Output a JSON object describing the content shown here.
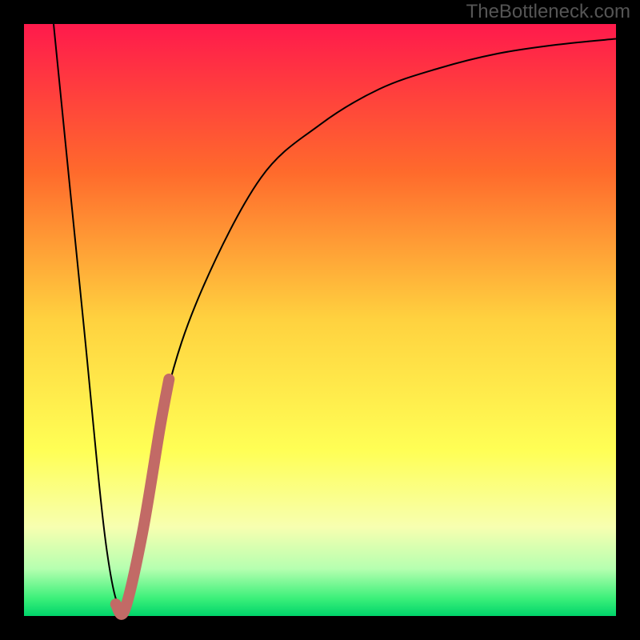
{
  "watermark": "TheBottleneck.com",
  "chart_data": {
    "type": "line",
    "title": "",
    "xlabel": "",
    "ylabel": "",
    "xlim": [
      0,
      100
    ],
    "ylim": [
      0,
      100
    ],
    "series": [
      {
        "name": "black-curve",
        "x": [
          5,
          10,
          14,
          17,
          20,
          24,
          30,
          40,
          50,
          60,
          70,
          80,
          90,
          100
        ],
        "values": [
          100,
          50,
          11,
          1,
          14,
          37,
          55,
          74,
          83,
          89,
          92.5,
          95,
          96.5,
          97.5
        ]
      },
      {
        "name": "highlight-segment",
        "x": [
          15.5,
          17,
          20,
          23,
          24.5
        ],
        "values": [
          2,
          1,
          14,
          32,
          40
        ]
      }
    ],
    "plot_background": {
      "stops": [
        {
          "pos": 0.0,
          "color": "#ff1a4c"
        },
        {
          "pos": 0.25,
          "color": "#ff6a2c"
        },
        {
          "pos": 0.5,
          "color": "#ffd23f"
        },
        {
          "pos": 0.72,
          "color": "#ffff55"
        },
        {
          "pos": 0.85,
          "color": "#f7ffb0"
        },
        {
          "pos": 0.92,
          "color": "#b6ffb0"
        },
        {
          "pos": 0.97,
          "color": "#3cf07a"
        },
        {
          "pos": 1.0,
          "color": "#00d46a"
        }
      ]
    },
    "frame_color": "#000000",
    "frame_thickness": 30,
    "highlight_color": "#c26a66"
  }
}
